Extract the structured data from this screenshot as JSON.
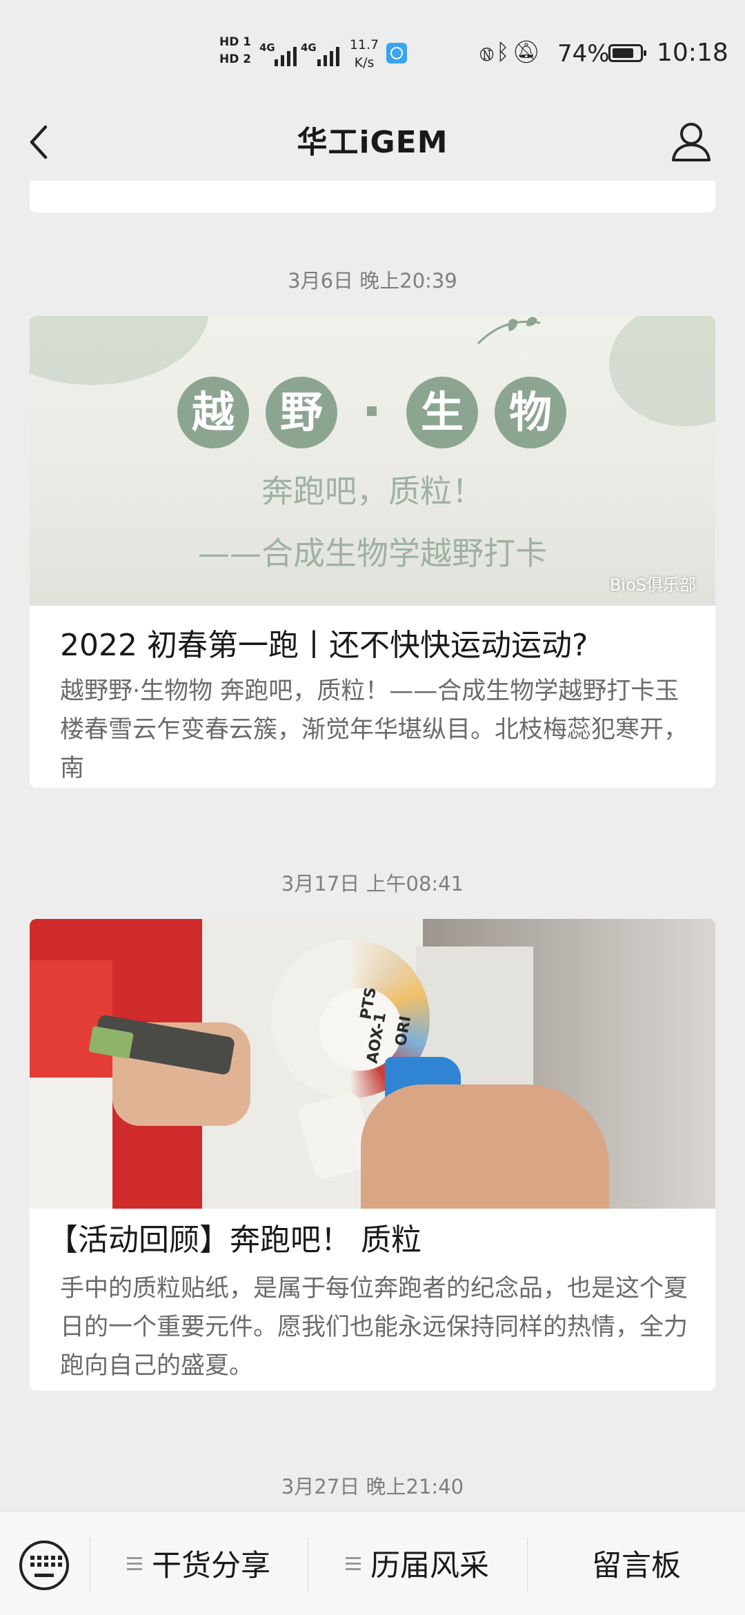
{
  "status_bar": {
    "hd1": "HD 1",
    "hd2": "HD 2",
    "net1": "4G",
    "net2": "4G",
    "speed_value": "11.7",
    "speed_unit": "K/s",
    "battery": "74%",
    "time": "10:18"
  },
  "header": {
    "title": "华工iGEM"
  },
  "feed": [
    {
      "timestamp": "3月6日 晚上20:39",
      "cover": {
        "chars": [
          "越",
          "野",
          "生",
          "物"
        ],
        "subtitle": "奔跑吧，质粒！",
        "line": "——合成生物学越野打卡",
        "watermark": "BioS俱乐部"
      },
      "title": "2022 初春第一跑丨还不快快运动运动?",
      "desc": "越野野·生物物 奔跑吧，质粒！——合成生物学越野打卡玉楼春雪云乍变春云簇，渐觉年华堪纵目。北枝梅蕊犯寒开，南"
    },
    {
      "timestamp": "3月17日 上午08:41",
      "cover": {
        "labels": [
          "PTS",
          "AOX-1",
          "ORI"
        ]
      },
      "title": "【活动回顾】奔跑吧！ 质粒",
      "desc": "手中的质粒贴纸，是属于每位奔跑者的纪念品，也是这个夏日的一个重要元件。愿我们也能永远保持同样的热情，全力跑向自己的盛夏。"
    },
    {
      "timestamp": "3月27日 晚上21:40"
    }
  ],
  "bottom_menu": {
    "items": [
      {
        "label": "干货分享"
      },
      {
        "label": "历届风采"
      },
      {
        "label": "留言板"
      }
    ]
  },
  "colors": {
    "background": "#ededed",
    "card": "#ffffff",
    "timestamp": "#7f7f7f",
    "desc": "#6b6b6b",
    "cover1_green": "#8ba591"
  }
}
